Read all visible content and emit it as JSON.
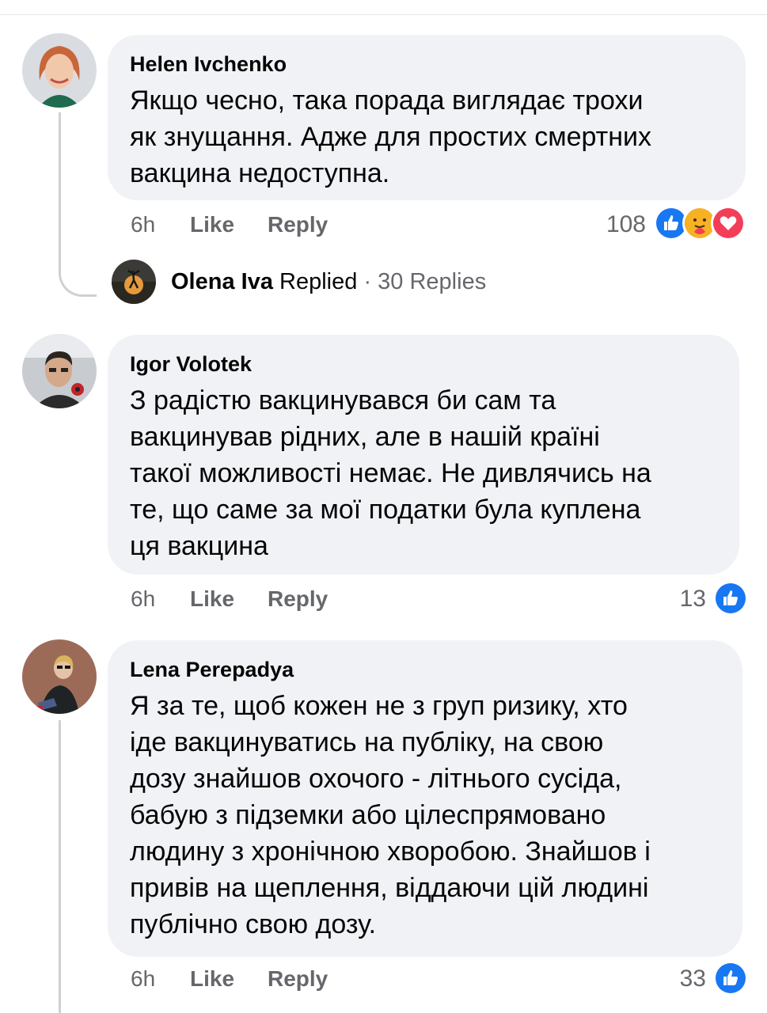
{
  "comments": [
    {
      "author": "Helen Ivchenko",
      "lines": [
        "Якщо чесно, така порада  виглядає трохи",
        "як знущання. Адже для простих смертних",
        "вакцина недоступна."
      ],
      "time": "6h",
      "like": "Like",
      "reply": "Reply",
      "reactions": "108",
      "reply_summary": {
        "name": "Olena Iva",
        "action": "Replied",
        "separator": "·",
        "count": "30 Replies"
      }
    },
    {
      "author": "Igor Volotek",
      "lines": [
        "З радістю вакцинувався би сам та",
        "вакцинував рідних, але в нашій країні",
        "такої можливості немає. Не дивлячись на",
        "те, що саме за мої податки була куплена",
        "ця вакцина"
      ],
      "time": "6h",
      "like": "Like",
      "reply": "Reply",
      "reactions": "13"
    },
    {
      "author": "Lena Perepadya",
      "lines": [
        "Я за те, щоб кожен не з груп ризику, хто",
        "іде вакцинуватись на публіку, на свою",
        "дозу знайшов охочого - літнього сусіда,",
        "бабую з підземки або цілеспрямовано",
        "людину з хронічною хворобою. Знайшов і",
        "привів на щеплення, віддаючи цій людині",
        "публічно свою дозу."
      ],
      "time": "6h",
      "like": "Like",
      "reply": "Reply",
      "reactions": "33"
    }
  ],
  "icons": {
    "like": "like-reaction-icon",
    "care": "care-reaction-icon",
    "love": "love-reaction-icon"
  },
  "colors": {
    "bubble": "#f0f2f5",
    "meta": "#65676b",
    "like_blue": "#1877f2",
    "love_red": "#f33e58",
    "care_yellow": "#f7b125"
  }
}
